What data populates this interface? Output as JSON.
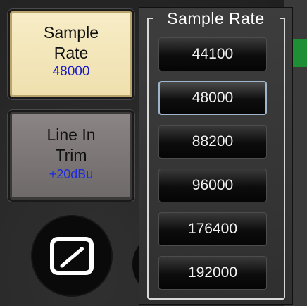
{
  "left_panel": {
    "sample_rate_button": {
      "title_line1": "Sample",
      "title_line2": "Rate",
      "value": "48000"
    },
    "line_in_trim_button": {
      "title_line1": "Line In",
      "title_line2": "Trim",
      "value": "+20dBu"
    }
  },
  "popup": {
    "title": "Sample Rate",
    "options": [
      "44100",
      "48000",
      "88200",
      "96000",
      "176400",
      "192000"
    ],
    "selected": "48000"
  },
  "icons": {
    "meter": "meter-icon"
  },
  "colors": {
    "value_blue": "#1a1ac8",
    "selected_border": "#9fb5cc",
    "active_button_bg": "#f3e6b8"
  }
}
